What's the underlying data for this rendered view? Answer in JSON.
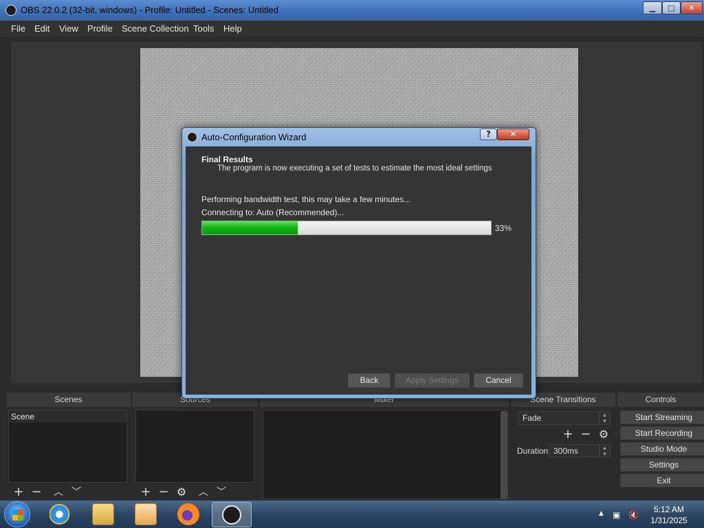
{
  "window": {
    "title": "OBS 22.0.2 (32-bit, windows) - Profile: Untitled - Scenes: Untitled",
    "min_icon": "minimize-icon",
    "max_icon": "maximize-icon",
    "close_icon": "close-icon"
  },
  "menu": [
    "File",
    "Edit",
    "View",
    "Profile",
    "Scene Collection",
    "Tools",
    "Help"
  ],
  "docks": {
    "scenes": {
      "header": "Scenes",
      "items": [
        "Scene"
      ]
    },
    "sources": {
      "header": "Sources"
    },
    "mixer": {
      "header": "Mixer"
    },
    "transitions": {
      "header": "Scene Transitions",
      "selected": "Fade",
      "duration_label": "Duration",
      "duration_value": "300ms"
    },
    "controls": {
      "header": "Controls",
      "buttons": [
        "Start Streaming",
        "Start Recording",
        "Studio Mode",
        "Settings",
        "Exit"
      ]
    }
  },
  "dialog": {
    "title": "Auto-Configuration Wizard",
    "help": "?",
    "heading": "Final Results",
    "subheading": "The program is now executing a set of tests to estimate the most ideal settings",
    "status_line": "Performing bandwidth test, this may take a few minutes...",
    "connecting_line": "Connecting to:  Auto (Recommended)...",
    "progress_percent": 33,
    "progress_label": "33%",
    "buttons": {
      "back": "Back",
      "apply": "Apply Settings",
      "cancel": "Cancel"
    }
  },
  "taskbar": {
    "icons": [
      "windows-start-icon",
      "internet-explorer-icon",
      "file-explorer-icon",
      "media-player-icon",
      "firefox-icon",
      "obs-icon"
    ],
    "time": "5:12 AM",
    "date": "1/31/2025"
  },
  "colors": {
    "progress_fill": "#16b416",
    "dark_bg": "#2b2b2b",
    "titlebar": "#3c6fb5"
  }
}
